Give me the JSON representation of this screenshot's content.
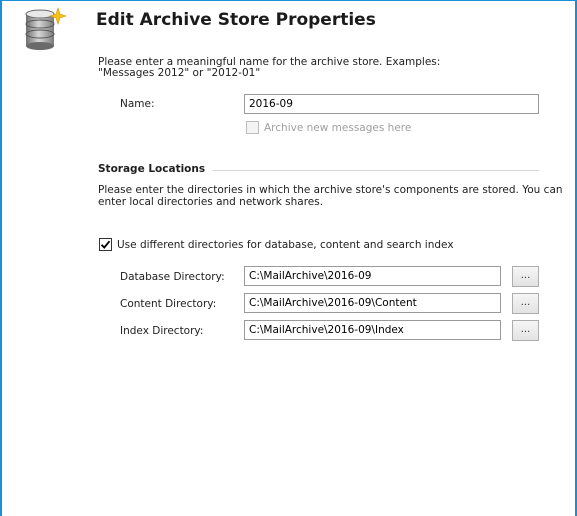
{
  "dialog": {
    "title": "Edit Archive Store Properties",
    "intro_line1": "Please enter a meaningful name for the archive store. Examples:",
    "intro_line2": "\"Messages 2012\" or \"2012-01\""
  },
  "name_field": {
    "label": "Name:",
    "value": "2016-09"
  },
  "archive_new": {
    "label": "Archive new messages here",
    "checked": false,
    "enabled": false
  },
  "storage": {
    "header": "Storage Locations",
    "desc_line1": "Please enter the directories in which the archive store's components are stored. You can",
    "desc_line2": "enter local directories and network shares.",
    "use_different": {
      "label": "Use different directories for database, content and search index",
      "checked": true
    },
    "database": {
      "label": "Database Directory:",
      "value": "C:\\MailArchive\\2016-09",
      "browse_label": "..."
    },
    "content": {
      "label": "Content Directory:",
      "value": "C:\\MailArchive\\2016-09\\Content",
      "browse_label": "..."
    },
    "index": {
      "label": "Index Directory:",
      "value": "C:\\MailArchive\\2016-09\\Index",
      "browse_label": "..."
    }
  },
  "icons": {
    "header_icon": "database-sparkle-icon"
  },
  "colors": {
    "frame": "#1a8fd6",
    "disabled_text": "#a0a0a0"
  }
}
